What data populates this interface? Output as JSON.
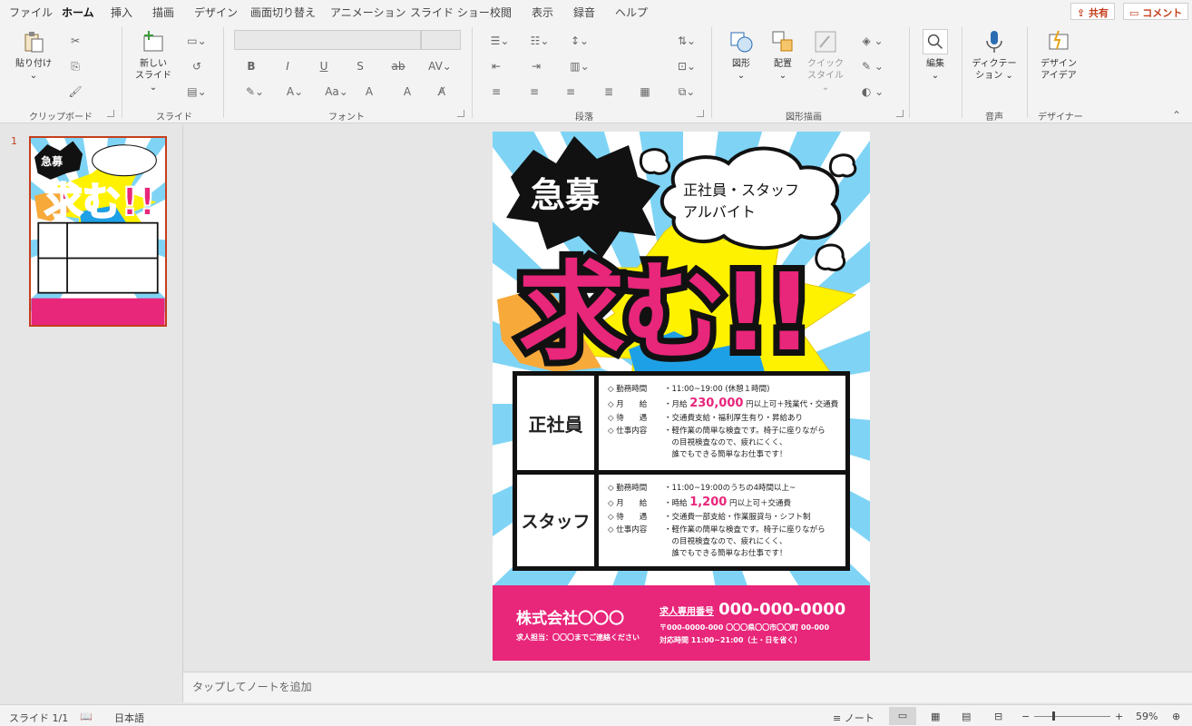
{
  "menu": {
    "tabs": [
      "ファイル",
      "ホーム",
      "挿入",
      "描画",
      "デザイン",
      "画面切り替え",
      "アニメーション",
      "スライド ショー",
      "校閲",
      "表示",
      "録音",
      "ヘルプ"
    ],
    "share": "共有",
    "comment": "コメント"
  },
  "ribbon": {
    "clipboard": {
      "paste": "貼り付け",
      "label": "クリップボード"
    },
    "slides": {
      "new_slide_1": "新しい",
      "new_slide_2": "スライド",
      "label": "スライド"
    },
    "font": {
      "label": "フォント"
    },
    "paragraph": {
      "label": "段落"
    },
    "drawing": {
      "shapes": "図形",
      "arrange": "配置",
      "quick1": "クイック",
      "quick2": "スタイル",
      "label": "図形描画"
    },
    "editing": {
      "edit": "編集"
    },
    "voice": {
      "dict1": "ディクテー",
      "dict2": "ション",
      "label": "音声"
    },
    "designer": {
      "d1": "デザイン",
      "d2": "アイデア",
      "label": "デザイナー"
    }
  },
  "thumbnail": {
    "number": "1"
  },
  "notes": {
    "placeholder": "タップしてノートを追加"
  },
  "status": {
    "slide": "スライド 1/1",
    "lang": "日本語",
    "notes": "ノート",
    "zoom": "59%"
  },
  "slide": {
    "kyubo": "急募",
    "bubble1": "正社員・スタッフ",
    "bubble2": "アルバイト",
    "motomu": "求む!!",
    "sections": [
      {
        "name": "正社員",
        "rows": [
          {
            "k": "◇ 勤務時間",
            "v": "・11:00~19:00 (休憩１時間)"
          },
          {
            "k": "◇ 月　　給",
            "v_pre": "・月給 ",
            "v_num": "230,000",
            "v_post": " 円以上可＋残業代・交通費"
          },
          {
            "k": "◇ 待　　遇",
            "v": "・交通費支給・福利厚生有り・昇給あり"
          },
          {
            "k": "◇ 仕事内容",
            "v": "・軽作業の簡単な検査です。椅子に座りながら"
          },
          {
            "k": "",
            "v": "　の目視検査なので、疲れにくく、"
          },
          {
            "k": "",
            "v": "　誰でもできる簡単なお仕事です！"
          }
        ]
      },
      {
        "name": "スタッフ",
        "rows": [
          {
            "k": "◇ 勤務時間",
            "v": "・11:00~19:00のうちの4時間以上~"
          },
          {
            "k": "◇ 月　　給",
            "v_pre": "・時給 ",
            "v_num": "1,200",
            "v_post": " 円以上可＋交通費"
          },
          {
            "k": "◇ 待　　遇",
            "v": "・交通費一部支給・作業服貸与・シフト制"
          },
          {
            "k": "◇ 仕事内容",
            "v": "・軽作業の簡単な検査です。椅子に座りながら"
          },
          {
            "k": "",
            "v": "　の目視検査なので、疲れにくく、"
          },
          {
            "k": "",
            "v": "　誰でもできる簡単なお仕事です！"
          }
        ]
      }
    ],
    "footer": {
      "company": "株式会社〇〇〇",
      "contact": "求人担当：〇〇〇までご連絡ください",
      "phone_label": "求人専用番号",
      "phone": "000-000-0000",
      "address": "〒000-0000-000 〇〇〇県〇〇市〇〇町 00-000",
      "hours": "対応時間 11:00~21:00（土・日を省く）"
    }
  },
  "colors": {
    "accent": "#c43e1c",
    "pink": "#e8267a",
    "blue": "#7fd4f5",
    "yellow": "#fff200",
    "orange": "#f7a93a"
  }
}
